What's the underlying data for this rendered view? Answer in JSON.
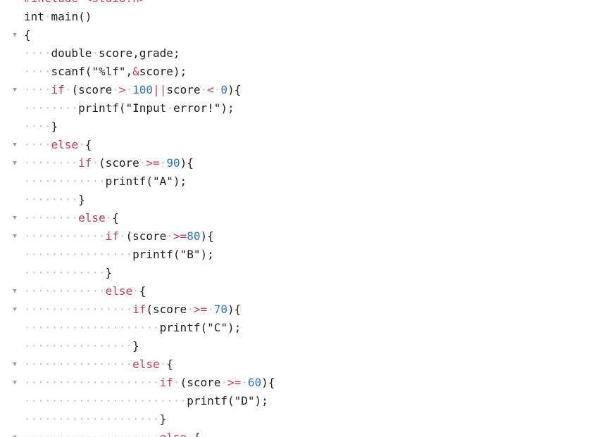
{
  "editor": {
    "lines": [
      {
        "fold": true,
        "tokens": [
          {
            "t": "kw",
            "v": "#include"
          },
          {
            "t": "ws",
            "v": "·"
          },
          {
            "t": "kw",
            "v": "<stdio.h>"
          }
        ]
      },
      {
        "fold": false,
        "tokens": [
          {
            "t": "id",
            "v": "int"
          },
          {
            "t": "ws",
            "v": "·"
          },
          {
            "t": "id",
            "v": "main()"
          }
        ]
      },
      {
        "fold": true,
        "tokens": [
          {
            "t": "p",
            "v": "{"
          }
        ]
      },
      {
        "fold": false,
        "tokens": [
          {
            "t": "ws",
            "v": "····"
          },
          {
            "t": "id",
            "v": "double"
          },
          {
            "t": "ws",
            "v": "·"
          },
          {
            "t": "id",
            "v": "score,grade;"
          }
        ]
      },
      {
        "fold": false,
        "tokens": [
          {
            "t": "ws",
            "v": "····"
          },
          {
            "t": "id",
            "v": "scanf(\"%lf\","
          },
          {
            "t": "op",
            "v": "&"
          },
          {
            "t": "id",
            "v": "score);"
          }
        ]
      },
      {
        "fold": true,
        "tokens": [
          {
            "t": "ws",
            "v": "····"
          },
          {
            "t": "kw",
            "v": "if"
          },
          {
            "t": "ws",
            "v": "·"
          },
          {
            "t": "id",
            "v": "(score"
          },
          {
            "t": "ws",
            "v": "·"
          },
          {
            "t": "op",
            "v": ">"
          },
          {
            "t": "ws",
            "v": "·"
          },
          {
            "t": "num",
            "v": "100"
          },
          {
            "t": "op",
            "v": "||"
          },
          {
            "t": "id",
            "v": "score"
          },
          {
            "t": "ws",
            "v": "·"
          },
          {
            "t": "op",
            "v": "<"
          },
          {
            "t": "ws",
            "v": "·"
          },
          {
            "t": "num",
            "v": "0"
          },
          {
            "t": "id",
            "v": "){"
          }
        ]
      },
      {
        "fold": false,
        "tokens": [
          {
            "t": "ws",
            "v": "········"
          },
          {
            "t": "id",
            "v": "printf(\"Input"
          },
          {
            "t": "ws",
            "v": "·"
          },
          {
            "t": "id",
            "v": "error!\");"
          }
        ]
      },
      {
        "fold": false,
        "tokens": [
          {
            "t": "ws",
            "v": "····"
          },
          {
            "t": "p",
            "v": "}"
          }
        ]
      },
      {
        "fold": true,
        "tokens": [
          {
            "t": "ws",
            "v": "····"
          },
          {
            "t": "kw",
            "v": "else"
          },
          {
            "t": "ws",
            "v": "·"
          },
          {
            "t": "p",
            "v": "{"
          }
        ]
      },
      {
        "fold": true,
        "tokens": [
          {
            "t": "ws",
            "v": "········"
          },
          {
            "t": "kw",
            "v": "if"
          },
          {
            "t": "ws",
            "v": "·"
          },
          {
            "t": "id",
            "v": "(score"
          },
          {
            "t": "ws",
            "v": "·"
          },
          {
            "t": "op",
            "v": ">="
          },
          {
            "t": "ws",
            "v": "·"
          },
          {
            "t": "num",
            "v": "90"
          },
          {
            "t": "id",
            "v": "){"
          }
        ]
      },
      {
        "fold": false,
        "tokens": [
          {
            "t": "ws",
            "v": "············"
          },
          {
            "t": "id",
            "v": "printf(\"A\");"
          }
        ]
      },
      {
        "fold": false,
        "tokens": [
          {
            "t": "ws",
            "v": "········"
          },
          {
            "t": "p",
            "v": "}"
          }
        ]
      },
      {
        "fold": true,
        "tokens": [
          {
            "t": "ws",
            "v": "········"
          },
          {
            "t": "kw",
            "v": "else"
          },
          {
            "t": "ws",
            "v": "·"
          },
          {
            "t": "p",
            "v": "{"
          }
        ]
      },
      {
        "fold": true,
        "tokens": [
          {
            "t": "ws",
            "v": "············"
          },
          {
            "t": "kw",
            "v": "if"
          },
          {
            "t": "ws",
            "v": "·"
          },
          {
            "t": "id",
            "v": "(score"
          },
          {
            "t": "ws",
            "v": "·"
          },
          {
            "t": "op",
            "v": ">="
          },
          {
            "t": "num",
            "v": "80"
          },
          {
            "t": "id",
            "v": "){"
          }
        ]
      },
      {
        "fold": false,
        "tokens": [
          {
            "t": "ws",
            "v": "················"
          },
          {
            "t": "id",
            "v": "printf(\"B\");"
          }
        ]
      },
      {
        "fold": false,
        "tokens": [
          {
            "t": "ws",
            "v": "············"
          },
          {
            "t": "p",
            "v": "}"
          }
        ]
      },
      {
        "fold": true,
        "tokens": [
          {
            "t": "ws",
            "v": "············"
          },
          {
            "t": "kw",
            "v": "else"
          },
          {
            "t": "ws",
            "v": "·"
          },
          {
            "t": "p",
            "v": "{"
          }
        ]
      },
      {
        "fold": true,
        "tokens": [
          {
            "t": "ws",
            "v": "················"
          },
          {
            "t": "kw",
            "v": "if"
          },
          {
            "t": "id",
            "v": "(score"
          },
          {
            "t": "ws",
            "v": "·"
          },
          {
            "t": "op",
            "v": ">="
          },
          {
            "t": "ws",
            "v": "·"
          },
          {
            "t": "num",
            "v": "70"
          },
          {
            "t": "id",
            "v": "){"
          }
        ]
      },
      {
        "fold": false,
        "tokens": [
          {
            "t": "ws",
            "v": "····················"
          },
          {
            "t": "id",
            "v": "printf(\"C\");"
          }
        ]
      },
      {
        "fold": false,
        "tokens": [
          {
            "t": "ws",
            "v": "················"
          },
          {
            "t": "p",
            "v": "}"
          }
        ]
      },
      {
        "fold": true,
        "tokens": [
          {
            "t": "ws",
            "v": "················"
          },
          {
            "t": "kw",
            "v": "else"
          },
          {
            "t": "ws",
            "v": "·"
          },
          {
            "t": "p",
            "v": "{"
          }
        ]
      },
      {
        "fold": true,
        "tokens": [
          {
            "t": "ws",
            "v": "····················"
          },
          {
            "t": "kw",
            "v": "if"
          },
          {
            "t": "ws",
            "v": "·"
          },
          {
            "t": "id",
            "v": "(score"
          },
          {
            "t": "ws",
            "v": "·"
          },
          {
            "t": "op",
            "v": ">="
          },
          {
            "t": "ws",
            "v": "·"
          },
          {
            "t": "num",
            "v": "60"
          },
          {
            "t": "id",
            "v": "){"
          }
        ]
      },
      {
        "fold": false,
        "tokens": [
          {
            "t": "ws",
            "v": "························"
          },
          {
            "t": "id",
            "v": "printf(\"D\");"
          }
        ]
      },
      {
        "fold": false,
        "tokens": [
          {
            "t": "ws",
            "v": "····················"
          },
          {
            "t": "p",
            "v": "}"
          }
        ]
      },
      {
        "fold": true,
        "tokens": [
          {
            "t": "ws",
            "v": "····················"
          },
          {
            "t": "kw",
            "v": "else"
          },
          {
            "t": "ws",
            "v": "·"
          },
          {
            "t": "p",
            "v": "{"
          }
        ]
      }
    ]
  },
  "colors": {
    "keyword": "#c53a56",
    "number": "#2d76c4",
    "text": "#1f1f1f",
    "whitespace_marker": "#c3c3c3",
    "fold_arrow": "#9a9a9a",
    "background": "#ffffff"
  },
  "icons": {
    "fold": "chevron-down-icon"
  }
}
